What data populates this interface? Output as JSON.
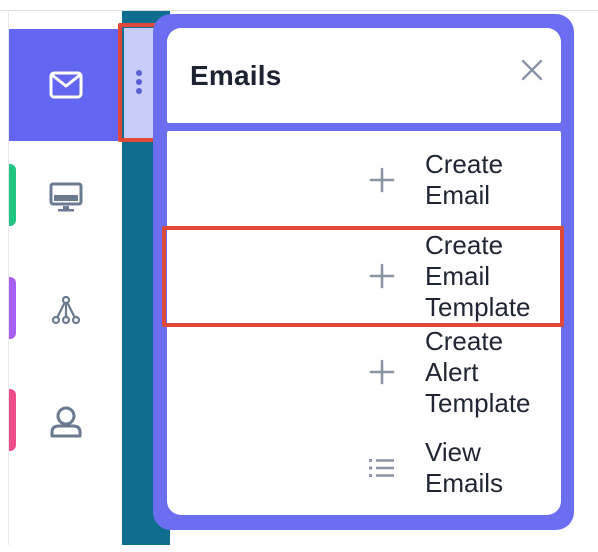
{
  "popup": {
    "title": "Emails",
    "close_icon": "close-icon",
    "items": [
      {
        "label": "Create Email",
        "icon": "plus-icon"
      },
      {
        "label": "Create Email Template",
        "icon": "plus-icon"
      },
      {
        "label": "Create Alert Template",
        "icon": "plus-icon"
      },
      {
        "label": "View Emails",
        "icon": "list-icon"
      }
    ]
  },
  "sidebar": {
    "items": [
      {
        "icon": "mail-icon",
        "active": true
      },
      {
        "icon": "monitor-icon",
        "accent": "#22c483"
      },
      {
        "icon": "hierarchy-icon",
        "accent": "#a960f2"
      },
      {
        "icon": "user-icon",
        "accent": "#ee4d8c"
      }
    ]
  },
  "colors": {
    "active_sidebar": "#6366f1",
    "popup_frame": "#6b6ef0",
    "teal_strip": "#0f6d8f",
    "highlight": "#e0483a"
  }
}
